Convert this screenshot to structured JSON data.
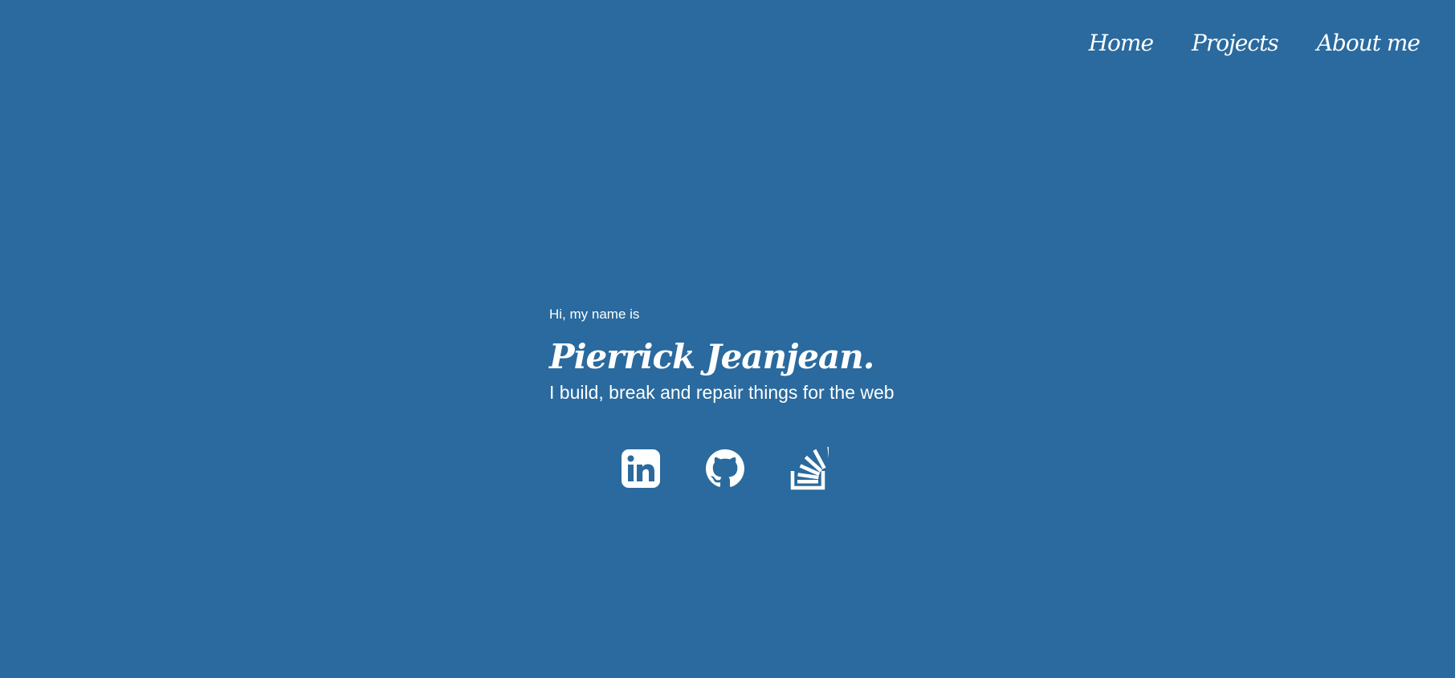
{
  "nav": {
    "items": [
      {
        "label": "Home"
      },
      {
        "label": "Projects"
      },
      {
        "label": "About me"
      }
    ]
  },
  "hero": {
    "greeting": "Hi, my name is",
    "name": "Pierrick Jeanjean.",
    "tagline": "I build, break and repair things for the web"
  },
  "social": {
    "links": [
      {
        "icon": "linkedin-icon"
      },
      {
        "icon": "github-icon"
      },
      {
        "icon": "stackoverflow-icon"
      }
    ]
  },
  "colors": {
    "background": "#2a6a9e",
    "text": "#ffffff"
  }
}
